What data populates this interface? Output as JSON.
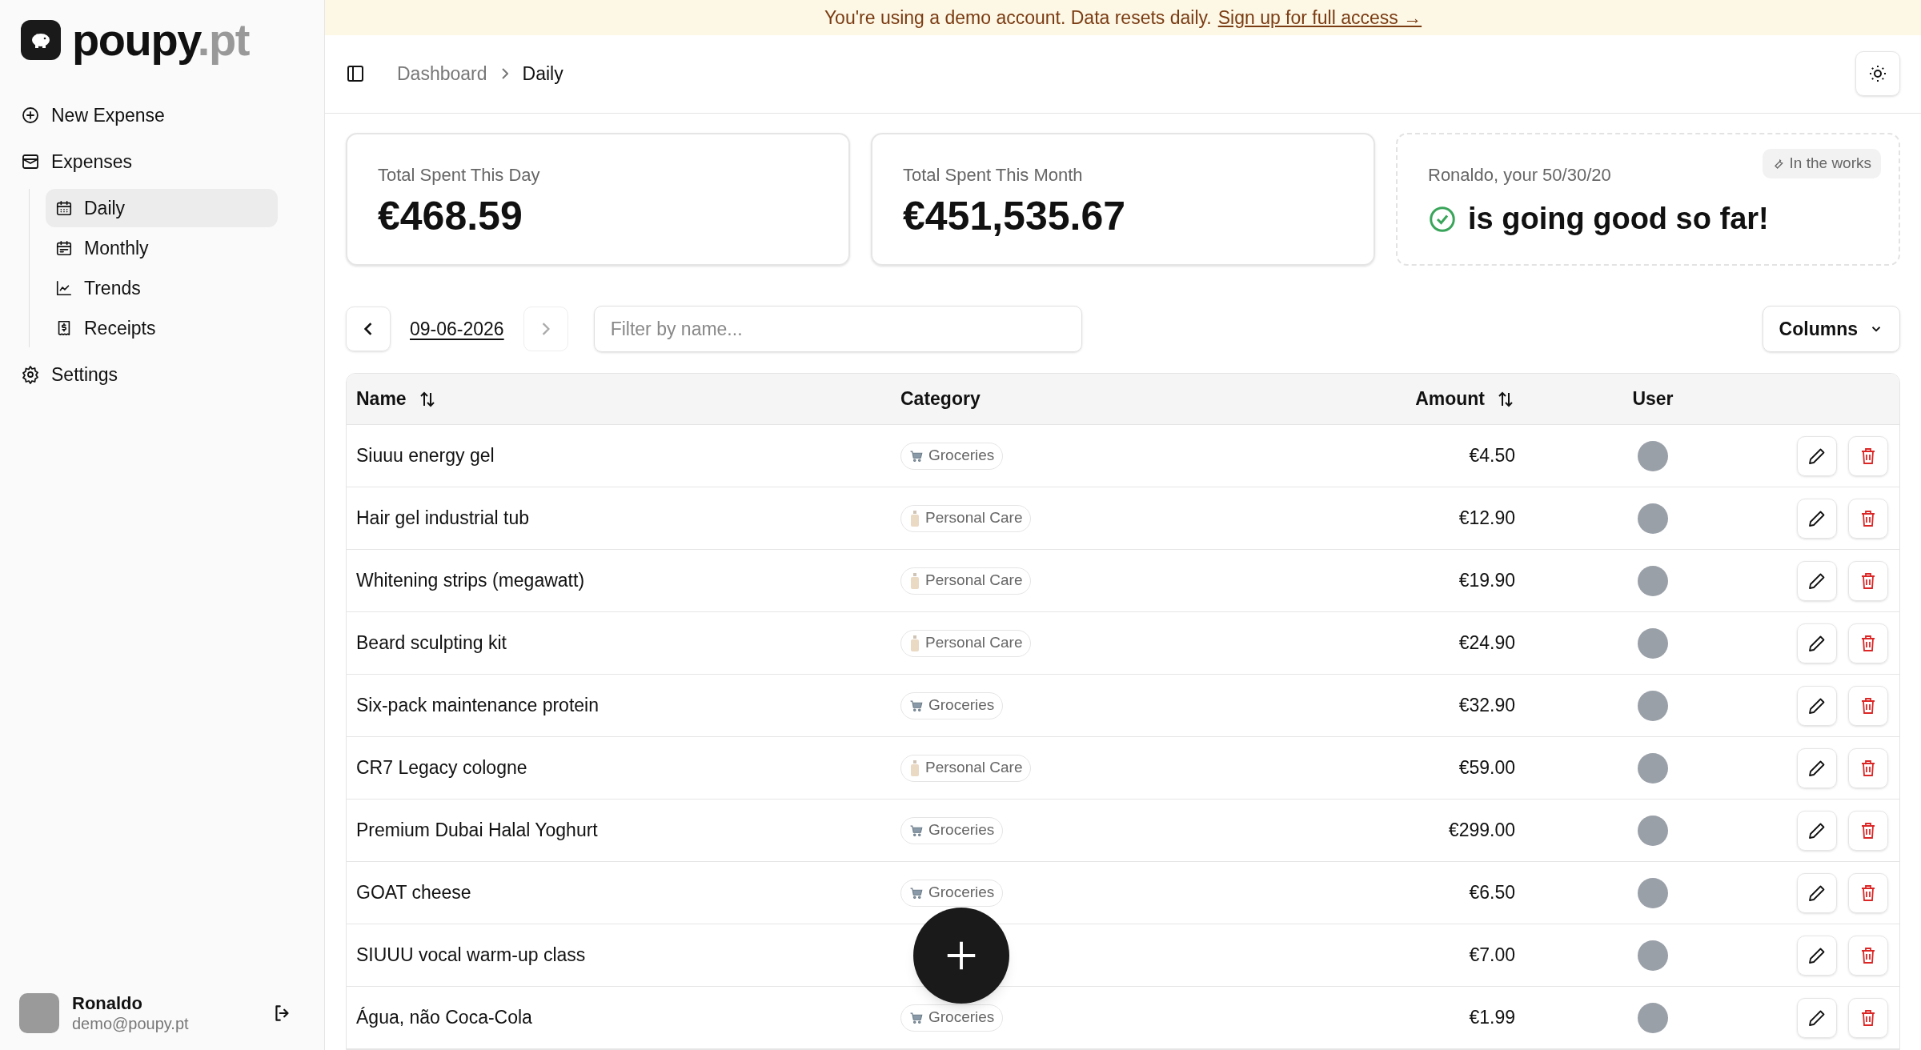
{
  "sidebar": {
    "logo": {
      "word": "poupy",
      "suffix": ".pt"
    },
    "items": [
      {
        "label": "New Expense",
        "selected": false
      },
      {
        "label": "Expenses",
        "selected": false,
        "children": [
          {
            "label": "Daily",
            "selected": true
          },
          {
            "label": "Monthly",
            "selected": false
          },
          {
            "label": "Trends",
            "selected": false
          },
          {
            "label": "Receipts",
            "selected": false
          }
        ]
      },
      {
        "label": "Settings",
        "selected": false
      }
    ],
    "user": {
      "name": "Ronaldo",
      "email": "demo@poupy.pt"
    }
  },
  "banner": {
    "text": "You're using a demo account. Data resets daily.",
    "link": "Sign up for full access →"
  },
  "breadcrumb": [
    "Dashboard",
    "Daily"
  ],
  "cards": [
    {
      "kind": "stat",
      "label": "Total Spent This Day",
      "value": "€468.59"
    },
    {
      "kind": "stat",
      "label": "Total Spent This Month",
      "value": "€451,535.67"
    },
    {
      "kind": "status",
      "label": "Ronaldo, your 50/30/20",
      "value": "is going good so far!",
      "badge": "In the works"
    }
  ],
  "toolbar": {
    "date": "09-06-2026",
    "next_disabled": true,
    "filter_placeholder": "Filter by name...",
    "columns_button": "Columns"
  },
  "table": {
    "columns": [
      {
        "label": "Name",
        "sortable": true
      },
      {
        "label": "Category",
        "sortable": false
      },
      {
        "label": "Amount",
        "sortable": true
      },
      {
        "label": "User",
        "sortable": false
      }
    ],
    "rows": [
      {
        "name": "Siuuu energy gel",
        "category": "Groceries",
        "kind": "groceries",
        "amount": "€4.50"
      },
      {
        "name": "Hair gel industrial tub",
        "category": "Personal Care",
        "kind": "personal_care",
        "amount": "€12.90"
      },
      {
        "name": "Whitening strips (megawatt)",
        "category": "Personal Care",
        "kind": "personal_care",
        "amount": "€19.90"
      },
      {
        "name": "Beard sculpting kit",
        "category": "Personal Care",
        "kind": "personal_care",
        "amount": "€24.90"
      },
      {
        "name": "Six-pack maintenance protein",
        "category": "Groceries",
        "kind": "groceries",
        "amount": "€32.90"
      },
      {
        "name": "CR7 Legacy cologne",
        "category": "Personal Care",
        "kind": "personal_care",
        "amount": "€59.00"
      },
      {
        "name": "Premium Dubai Halal Yoghurt",
        "category": "Groceries",
        "kind": "groceries",
        "amount": "€299.00"
      },
      {
        "name": "GOAT cheese",
        "category": "Groceries",
        "kind": "groceries",
        "amount": "€6.50"
      },
      {
        "name": "SIUUU vocal warm-up class",
        "kind": "none",
        "amount": "€7.00"
      },
      {
        "name": "Água, não Coca-Cola",
        "category": "Groceries",
        "kind": "groceries",
        "amount": "€1.99"
      }
    ]
  }
}
